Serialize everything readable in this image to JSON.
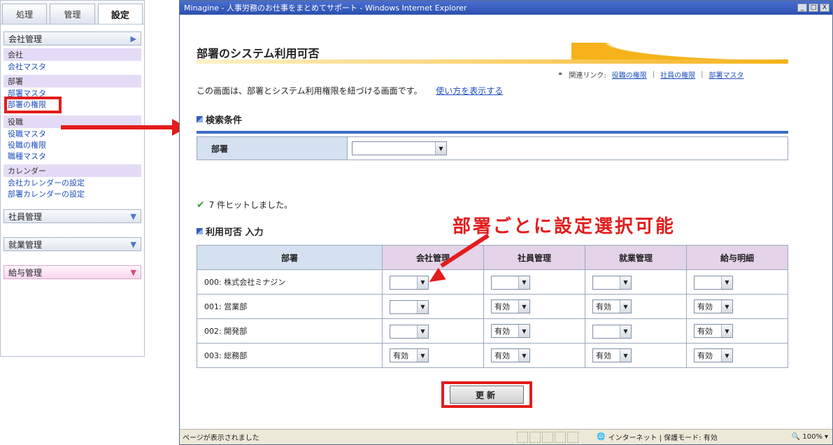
{
  "nav": {
    "tabs": [
      "処理",
      "管理",
      "設定"
    ],
    "sections": [
      {
        "label": "会社管理"
      },
      {
        "label": "社員管理"
      },
      {
        "label": "就業管理"
      },
      {
        "label": "給与管理"
      }
    ],
    "groups": [
      {
        "label": "会社",
        "links": [
          "会社マスタ"
        ]
      },
      {
        "label": "部署",
        "links": [
          "部署マスタ",
          "部署の権限"
        ]
      },
      {
        "label": "役職",
        "links": [
          "役職マスタ",
          "役職の権限",
          "職種マスタ"
        ]
      },
      {
        "label": "カレンダー",
        "links": [
          "会社カレンダーの設定",
          "部署カレンダーの設定"
        ]
      }
    ]
  },
  "window": {
    "title": "Minagine - 人事労務のお仕事をまとめてサポート - Windows Internet Explorer",
    "min": "_",
    "max": "□",
    "close": "X"
  },
  "page": {
    "title": "部署のシステム利用可否",
    "related_label": "関連リンク:",
    "related_links": [
      "役職の権限",
      "社員の権限",
      "部署マスタ"
    ],
    "description": "この画面は、部署とシステム利用権限を紐づける画面です。",
    "how_to_link": "使い方を表示する",
    "search_title": "検索条件",
    "search_label": "部署",
    "search_value": "",
    "hit_message": "7 件ヒットしました。",
    "input_title": "利用可否 入力",
    "columns": [
      "部署",
      "会社管理",
      "社員管理",
      "就業管理",
      "給与明細"
    ],
    "rows": [
      {
        "dept": "000: 株式会社ミナジン",
        "values": [
          "",
          "",
          "",
          ""
        ]
      },
      {
        "dept": "001: 営業部",
        "values": [
          "",
          "有効",
          "有効",
          "有効"
        ]
      },
      {
        "dept": "002: 開発部",
        "values": [
          "",
          "有効",
          "",
          "有効"
        ]
      },
      {
        "dept": "003: 総務部",
        "values": [
          "有効",
          "有効",
          "有効",
          "有効"
        ]
      }
    ],
    "update_button": "更新"
  },
  "annotation": {
    "callout": "部署ごとに設定選択可能"
  },
  "status": {
    "text": "ページが表示されました",
    "zone": "インターネット | 保護モード: 有効",
    "zoom": "100%"
  },
  "colors": {
    "highlight": "#e31c1c",
    "accent_blue": "#3d6cc7",
    "title_orange": "#f5b21a"
  }
}
